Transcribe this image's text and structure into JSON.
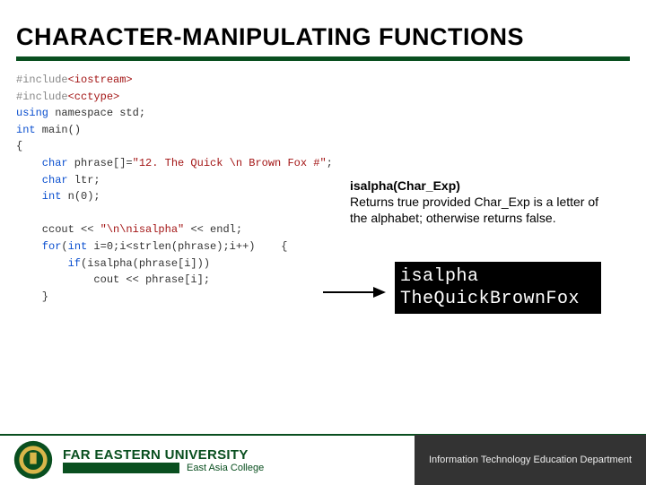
{
  "title": "CHARACTER-MANIPULATING FUNCTIONS",
  "code": {
    "l1a": "#include",
    "l1b": "<iostream>",
    "l2a": "#include",
    "l2b": "<cctype>",
    "l3a": "using",
    "l3b": " namespace std;",
    "l4a": "int",
    "l4b": " main()",
    "l5": "{",
    "l6a": "    char",
    "l6b": " phrase[]=",
    "l6c": "\"12. The Quick \\n Brown Fox #\"",
    "l6d": ";",
    "l7a": "    char",
    "l7b": " ltr;",
    "l8a": "    int",
    "l8b": " n(0);",
    "l9": "",
    "l10a": "    ccout << ",
    "l10b": "\"\\n\\nisalpha\"",
    "l10c": " << endl;",
    "l11a": "    for",
    "l11b": "(",
    "l11c": "int",
    "l11d": " i=0;i<strlen(phrase);i++)    {",
    "l12a": "        if",
    "l12b": "(isalpha(phrase[i]))",
    "l13": "            cout << phrase[i];",
    "l14": "    }"
  },
  "explain": {
    "sig": "isalpha(Char_Exp)",
    "body": "Returns true provided Char_Exp is a letter of the alphabet; otherwise returns false."
  },
  "console": {
    "line1": "isalpha",
    "line2": "TheQuickBrownFox"
  },
  "footer": {
    "university": "FAR EASTERN UNIVERSITY",
    "college": "East Asia College",
    "department": "Information Technology Education Department"
  }
}
